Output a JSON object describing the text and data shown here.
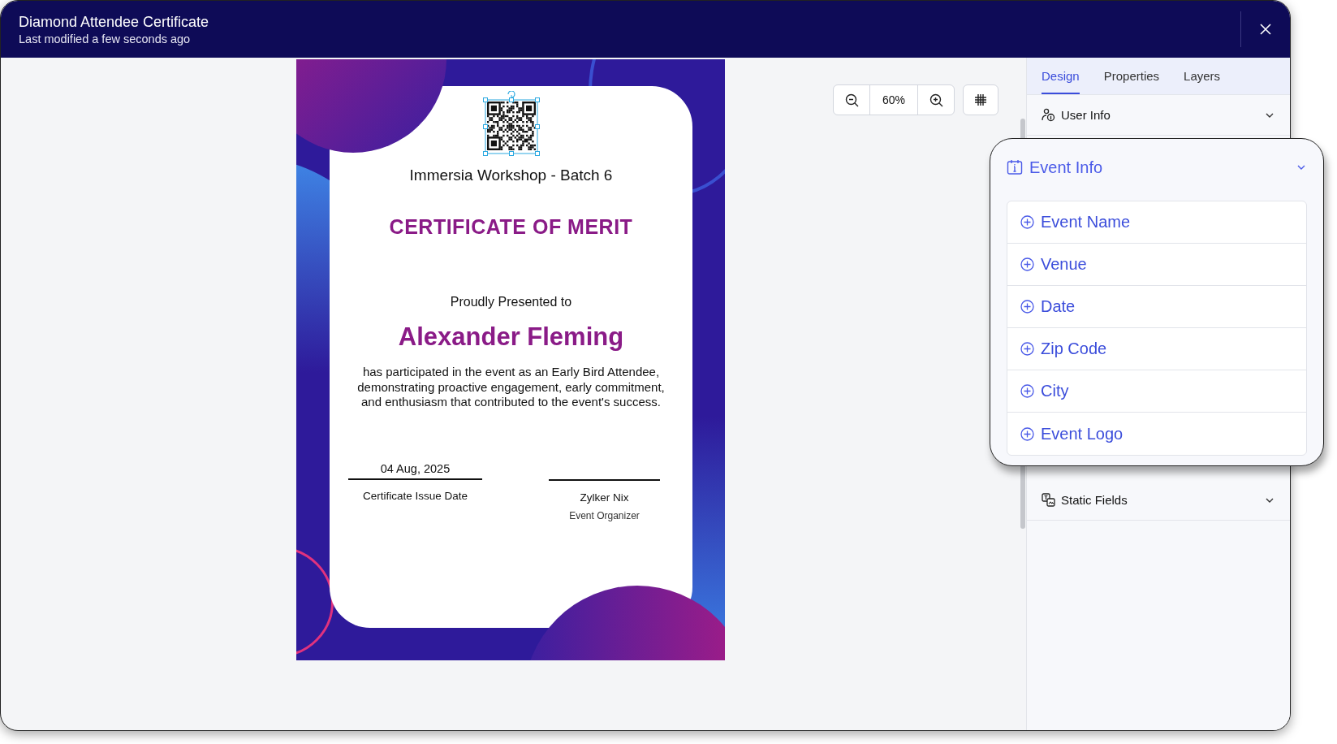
{
  "window": {
    "title": "Diamond Attendee Certificate",
    "subtitle": "Last modified a few seconds ago"
  },
  "certificate": {
    "event": "Immersia Workshop - Batch 6",
    "heading": "CERTIFICATE OF MERIT",
    "presented": "Proudly Presented to",
    "recipient": "Alexander Fleming",
    "description": "has participated in the event as an Early Bird Attendee, demonstrating proactive engagement, early commitment, and enthusiasm that contributed to the event's success.",
    "date": "04 Aug, 2025",
    "date_label": "Certificate Issue Date",
    "signer": "Zylker Nix",
    "signer_role": "Event Organizer"
  },
  "zoom": {
    "value": "60%"
  },
  "panel": {
    "tabs": [
      {
        "label": "Design",
        "selected": true
      },
      {
        "label": "Properties",
        "selected": false
      },
      {
        "label": "Layers",
        "selected": false
      }
    ],
    "sections": [
      {
        "title": "User Info",
        "expanded": false
      },
      {
        "title": "Event Info",
        "expanded": true,
        "items": [
          "Event Name",
          "Venue",
          "Date",
          "Zip Code",
          "City",
          "Event Logo"
        ]
      },
      {
        "title": "Static Fields",
        "expanded": false
      }
    ]
  }
}
